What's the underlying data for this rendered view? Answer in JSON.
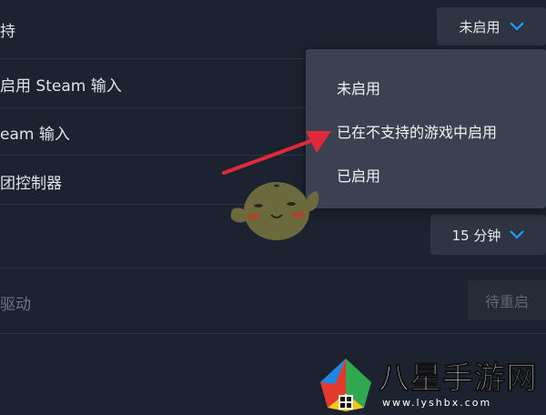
{
  "rows": {
    "row1_label": "持",
    "row1_value": "未启用",
    "row2_label": "启用 Steam 输入",
    "row3_label": "eam 输入",
    "row4_label": "团控制器",
    "row5_value": "15 分钟",
    "row6_label": "驱动",
    "row6_button": "待重启"
  },
  "menu": {
    "items": [
      "未启用",
      "已在不支持的游戏中启用",
      "已启用"
    ]
  },
  "watermark": {
    "brand": "八星手游网",
    "url": "www.lyshbx.com"
  },
  "colors": {
    "background": "#1d2230",
    "accent_chevron": "#1a9fff",
    "arrow": "#e0293a"
  }
}
